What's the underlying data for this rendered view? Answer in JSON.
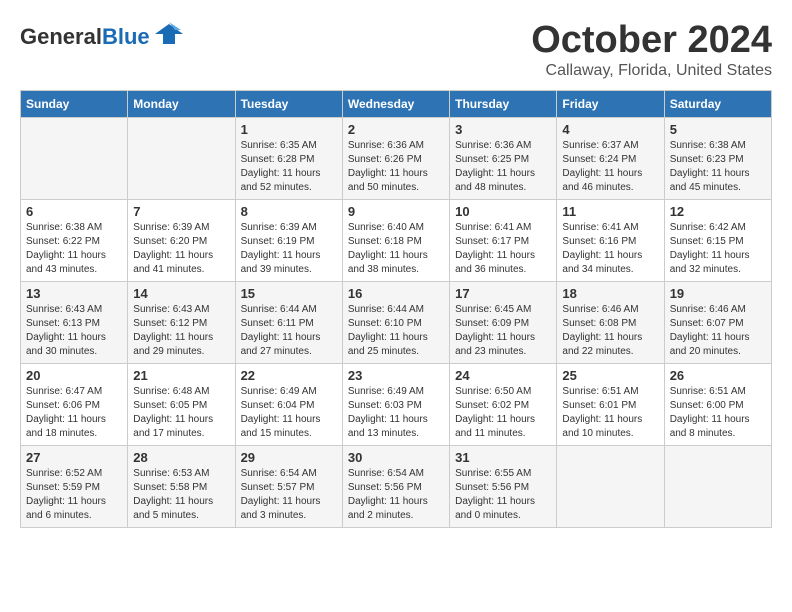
{
  "logo": {
    "general": "General",
    "blue": "Blue"
  },
  "header": {
    "month": "October 2024",
    "location": "Callaway, Florida, United States"
  },
  "weekdays": [
    "Sunday",
    "Monday",
    "Tuesday",
    "Wednesday",
    "Thursday",
    "Friday",
    "Saturday"
  ],
  "weeks": [
    [
      {
        "day": "",
        "text": ""
      },
      {
        "day": "",
        "text": ""
      },
      {
        "day": "1",
        "text": "Sunrise: 6:35 AM\nSunset: 6:28 PM\nDaylight: 11 hours and 52 minutes."
      },
      {
        "day": "2",
        "text": "Sunrise: 6:36 AM\nSunset: 6:26 PM\nDaylight: 11 hours and 50 minutes."
      },
      {
        "day": "3",
        "text": "Sunrise: 6:36 AM\nSunset: 6:25 PM\nDaylight: 11 hours and 48 minutes."
      },
      {
        "day": "4",
        "text": "Sunrise: 6:37 AM\nSunset: 6:24 PM\nDaylight: 11 hours and 46 minutes."
      },
      {
        "day": "5",
        "text": "Sunrise: 6:38 AM\nSunset: 6:23 PM\nDaylight: 11 hours and 45 minutes."
      }
    ],
    [
      {
        "day": "6",
        "text": "Sunrise: 6:38 AM\nSunset: 6:22 PM\nDaylight: 11 hours and 43 minutes."
      },
      {
        "day": "7",
        "text": "Sunrise: 6:39 AM\nSunset: 6:20 PM\nDaylight: 11 hours and 41 minutes."
      },
      {
        "day": "8",
        "text": "Sunrise: 6:39 AM\nSunset: 6:19 PM\nDaylight: 11 hours and 39 minutes."
      },
      {
        "day": "9",
        "text": "Sunrise: 6:40 AM\nSunset: 6:18 PM\nDaylight: 11 hours and 38 minutes."
      },
      {
        "day": "10",
        "text": "Sunrise: 6:41 AM\nSunset: 6:17 PM\nDaylight: 11 hours and 36 minutes."
      },
      {
        "day": "11",
        "text": "Sunrise: 6:41 AM\nSunset: 6:16 PM\nDaylight: 11 hours and 34 minutes."
      },
      {
        "day": "12",
        "text": "Sunrise: 6:42 AM\nSunset: 6:15 PM\nDaylight: 11 hours and 32 minutes."
      }
    ],
    [
      {
        "day": "13",
        "text": "Sunrise: 6:43 AM\nSunset: 6:13 PM\nDaylight: 11 hours and 30 minutes."
      },
      {
        "day": "14",
        "text": "Sunrise: 6:43 AM\nSunset: 6:12 PM\nDaylight: 11 hours and 29 minutes."
      },
      {
        "day": "15",
        "text": "Sunrise: 6:44 AM\nSunset: 6:11 PM\nDaylight: 11 hours and 27 minutes."
      },
      {
        "day": "16",
        "text": "Sunrise: 6:44 AM\nSunset: 6:10 PM\nDaylight: 11 hours and 25 minutes."
      },
      {
        "day": "17",
        "text": "Sunrise: 6:45 AM\nSunset: 6:09 PM\nDaylight: 11 hours and 23 minutes."
      },
      {
        "day": "18",
        "text": "Sunrise: 6:46 AM\nSunset: 6:08 PM\nDaylight: 11 hours and 22 minutes."
      },
      {
        "day": "19",
        "text": "Sunrise: 6:46 AM\nSunset: 6:07 PM\nDaylight: 11 hours and 20 minutes."
      }
    ],
    [
      {
        "day": "20",
        "text": "Sunrise: 6:47 AM\nSunset: 6:06 PM\nDaylight: 11 hours and 18 minutes."
      },
      {
        "day": "21",
        "text": "Sunrise: 6:48 AM\nSunset: 6:05 PM\nDaylight: 11 hours and 17 minutes."
      },
      {
        "day": "22",
        "text": "Sunrise: 6:49 AM\nSunset: 6:04 PM\nDaylight: 11 hours and 15 minutes."
      },
      {
        "day": "23",
        "text": "Sunrise: 6:49 AM\nSunset: 6:03 PM\nDaylight: 11 hours and 13 minutes."
      },
      {
        "day": "24",
        "text": "Sunrise: 6:50 AM\nSunset: 6:02 PM\nDaylight: 11 hours and 11 minutes."
      },
      {
        "day": "25",
        "text": "Sunrise: 6:51 AM\nSunset: 6:01 PM\nDaylight: 11 hours and 10 minutes."
      },
      {
        "day": "26",
        "text": "Sunrise: 6:51 AM\nSunset: 6:00 PM\nDaylight: 11 hours and 8 minutes."
      }
    ],
    [
      {
        "day": "27",
        "text": "Sunrise: 6:52 AM\nSunset: 5:59 PM\nDaylight: 11 hours and 6 minutes."
      },
      {
        "day": "28",
        "text": "Sunrise: 6:53 AM\nSunset: 5:58 PM\nDaylight: 11 hours and 5 minutes."
      },
      {
        "day": "29",
        "text": "Sunrise: 6:54 AM\nSunset: 5:57 PM\nDaylight: 11 hours and 3 minutes."
      },
      {
        "day": "30",
        "text": "Sunrise: 6:54 AM\nSunset: 5:56 PM\nDaylight: 11 hours and 2 minutes."
      },
      {
        "day": "31",
        "text": "Sunrise: 6:55 AM\nSunset: 5:56 PM\nDaylight: 11 hours and 0 minutes."
      },
      {
        "day": "",
        "text": ""
      },
      {
        "day": "",
        "text": ""
      }
    ]
  ]
}
